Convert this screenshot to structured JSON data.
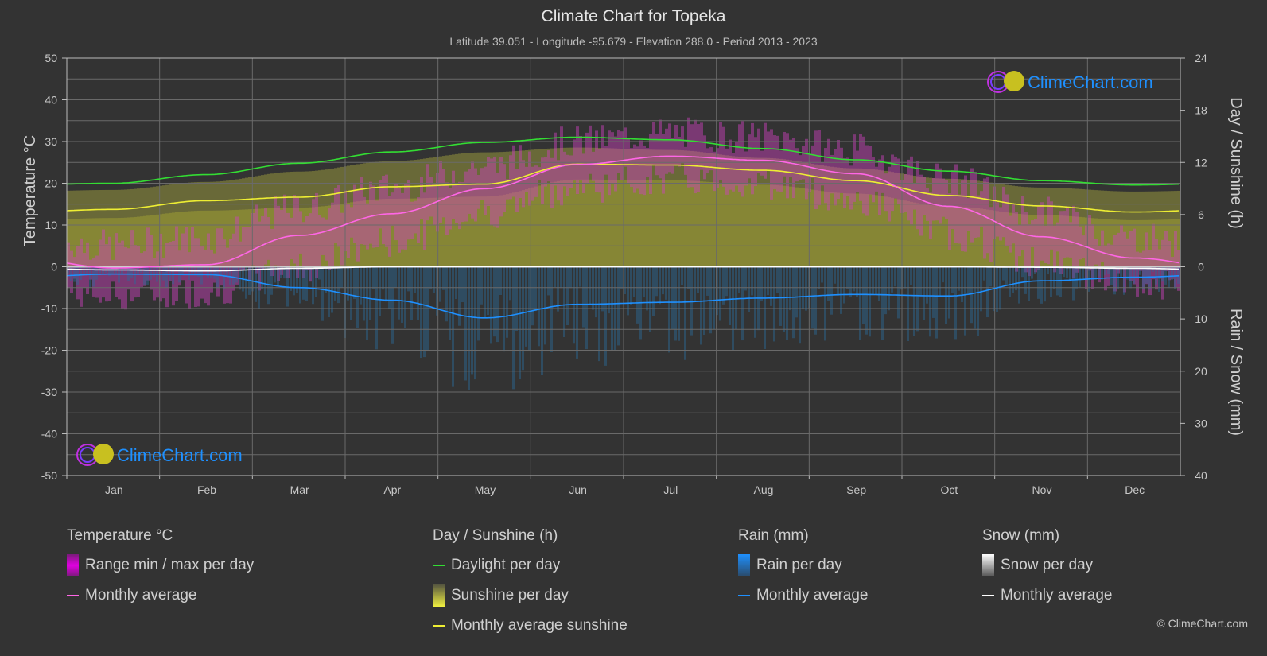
{
  "header": {
    "title": "Climate Chart for Topeka",
    "subtitle": "Latitude 39.051 - Longitude -95.679 - Elevation 288.0 - Period 2013 - 2023"
  },
  "watermark": {
    "text": "ClimeChart.com"
  },
  "copyright": "© ClimeChart.com",
  "colors": {
    "background": "#333333",
    "temp_avg": "#ff66e6",
    "temp_range": "#e000e0",
    "daylight": "#33dd33",
    "sunshine_avg": "#eeee33",
    "sunshine_fill": "#8a8a35",
    "rain_avg": "#1e90ff",
    "rain_fill": "#2a6a9a",
    "snow_avg": "#ffffff",
    "brand": "#1e90ff"
  },
  "legend": {
    "groups": [
      {
        "title": "Temperature °C",
        "items": [
          {
            "label": "Range min / max per day",
            "kind": "bar",
            "icon": "temp-range-swatch"
          },
          {
            "label": "Monthly average",
            "kind": "line",
            "icon": "temp-avg-swatch"
          }
        ]
      },
      {
        "title": "Day / Sunshine (h)",
        "items": [
          {
            "label": "Daylight per day",
            "kind": "line",
            "icon": "daylight-swatch"
          },
          {
            "label": "Sunshine per day",
            "kind": "bar",
            "icon": "sunshine-swatch"
          },
          {
            "label": "Monthly average sunshine",
            "kind": "line",
            "icon": "sunshine-avg-swatch"
          }
        ]
      },
      {
        "title": "Rain (mm)",
        "items": [
          {
            "label": "Rain per day",
            "kind": "bar",
            "icon": "rain-swatch"
          },
          {
            "label": "Monthly average",
            "kind": "line",
            "icon": "rain-avg-swatch"
          }
        ]
      },
      {
        "title": "Snow (mm)",
        "items": [
          {
            "label": "Snow per day",
            "kind": "bar",
            "icon": "snow-swatch"
          },
          {
            "label": "Monthly average",
            "kind": "line",
            "icon": "snow-avg-swatch"
          }
        ]
      }
    ]
  },
  "chart_data": {
    "type": "line",
    "title": "Climate Chart for Topeka",
    "subtitle": "Latitude 39.051 - Longitude -95.679 - Elevation 288.0 - Period 2013 - 2023",
    "categories": [
      "Jan",
      "Feb",
      "Mar",
      "Apr",
      "May",
      "Jun",
      "Jul",
      "Aug",
      "Sep",
      "Oct",
      "Nov",
      "Dec"
    ],
    "axes": {
      "left": {
        "label": "Temperature °C",
        "range": [
          -50,
          50
        ],
        "ticks": [
          50,
          40,
          30,
          20,
          10,
          0,
          -10,
          -20,
          -30,
          -40,
          -50
        ]
      },
      "right_top": {
        "label": "Day / Sunshine (h)",
        "range": [
          0,
          24
        ],
        "ticks": [
          24,
          18,
          12,
          6,
          0
        ]
      },
      "right_bottom": {
        "label": "Rain / Snow (mm)",
        "range": [
          0,
          40
        ],
        "ticks": [
          0,
          10,
          20,
          30,
          40
        ]
      }
    },
    "grid": true,
    "legend_position": "bottom",
    "series": [
      {
        "name": "Temperature monthly average",
        "axis": "left",
        "unit": "°C",
        "values": [
          -0.3,
          0.5,
          7.5,
          12.7,
          18.7,
          24.5,
          26.5,
          25.5,
          22.3,
          14.5,
          7.2,
          2.1
        ]
      },
      {
        "name": "Temperature daily max (approx.)",
        "axis": "left",
        "unit": "°C",
        "values": [
          5,
          7,
          14,
          19,
          24,
          30,
          32,
          31,
          28,
          21,
          13,
          7
        ]
      },
      {
        "name": "Temperature daily min (approx.)",
        "axis": "left",
        "unit": "°C",
        "values": [
          -7,
          -6,
          0,
          6,
          13,
          19,
          21,
          20,
          16,
          8,
          1,
          -4
        ]
      },
      {
        "name": "Daylight per day",
        "axis": "right_top",
        "unit": "h",
        "values": [
          9.6,
          10.6,
          11.9,
          13.2,
          14.3,
          14.9,
          14.6,
          13.6,
          12.3,
          11.0,
          9.9,
          9.4
        ]
      },
      {
        "name": "Monthly average sunshine",
        "axis": "right_top",
        "unit": "h",
        "values": [
          6.6,
          7.6,
          8.0,
          9.2,
          9.5,
          11.8,
          11.7,
          11.1,
          9.9,
          8.2,
          7.0,
          6.3
        ]
      },
      {
        "name": "Rain monthly average",
        "axis": "right_bottom",
        "unit": "mm",
        "values": [
          1.4,
          1.5,
          4.0,
          6.4,
          9.8,
          7.2,
          6.8,
          6.0,
          5.3,
          5.6,
          2.7,
          2.0
        ]
      },
      {
        "name": "Snow monthly average",
        "axis": "right_bottom",
        "unit": "mm",
        "values": [
          0.6,
          0.8,
          0.3,
          0.0,
          0.0,
          0.0,
          0.0,
          0.0,
          0.0,
          0.0,
          0.1,
          0.3
        ]
      }
    ]
  }
}
